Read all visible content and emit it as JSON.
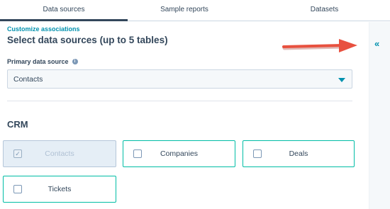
{
  "tabs": [
    {
      "label": "Data sources",
      "active": true
    },
    {
      "label": "Sample reports",
      "active": false
    },
    {
      "label": "Datasets",
      "active": false
    }
  ],
  "main": {
    "customize_link": "Customize associations",
    "heading": "Select data sources (up to 5 tables)",
    "primary_label": "Primary data source",
    "primary_value": "Contacts",
    "section_title": "CRM",
    "tiles": [
      {
        "label": "Contacts",
        "checked": true
      },
      {
        "label": "Companies",
        "checked": false
      },
      {
        "label": "Deals",
        "checked": false
      },
      {
        "label": "Tickets",
        "checked": false
      }
    ]
  },
  "icons": {
    "info": "info-icon",
    "dropdown": "chevron-down-icon",
    "collapse": "double-chevron-left-icon",
    "annotation": "red-arrow"
  },
  "colors": {
    "accent": "#0091ae",
    "tile_border": "#00bda5",
    "text": "#33475b",
    "arrow": "#e8513f"
  },
  "glyphs": {
    "info": "i",
    "check": "✓",
    "collapse": "«"
  }
}
